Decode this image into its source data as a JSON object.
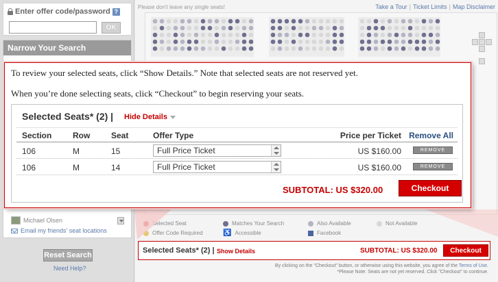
{
  "sidebar": {
    "offer_label": "Enter offer code/password",
    "offer_help": "?",
    "offer_input_value": "",
    "ok_label": "OK",
    "narrow_header": "Narrow Your Search",
    "friend_name": "Michael Olsen",
    "email_friends": "Email my friends' seat locations",
    "reset_label": "Reset Search",
    "need_help": "Need Help?"
  },
  "main": {
    "top_notice": "Please don't leave any single seats!",
    "links": [
      "Take a Tour",
      "Ticket Limits",
      "Map Disclaimer"
    ],
    "legend": [
      {
        "label": "Selected Seat",
        "shape": "dot",
        "color": "#d23a3a"
      },
      {
        "label": "Matches Your Search",
        "shape": "dot",
        "color": "#6f6f8f"
      },
      {
        "label": "Also Available",
        "shape": "dot",
        "color": "#b4b4c4"
      },
      {
        "label": "Not Available",
        "shape": "dot",
        "color": "#d8d8d8"
      },
      {
        "label": "Offer Code Required",
        "shape": "dot",
        "color": "#e6c870"
      },
      {
        "label": "Accessible",
        "shape": "icon",
        "color": "#6a7fa8"
      },
      {
        "label": "Facebook",
        "shape": "square",
        "color": "#4a65a0"
      }
    ],
    "bottom_title": "Selected Seats* (2) |",
    "bottom_show": "Show Details",
    "bottom_subtotal": "SUBTOTAL: US $320.00",
    "bottom_checkout": "Checkout",
    "terms_prefix": "By clicking on the \"Checkout\" button, or otherwise using this website, you agree of the",
    "terms_link": "Terms of Use.",
    "terms_note": "*Please Note: Seats are not yet reserved. Click \"Checkout\" to continue."
  },
  "callout": {
    "instruction1": "To review your selected seats, click “Show Details.” Note that selected seats are not reserved yet.",
    "instruction2": "When you’re done selecting seats, click “Checkout” to begin reserving your seats.",
    "panel_title": "Selected Seats* (2) |",
    "hide_details": "Hide Details",
    "headers": {
      "section": "Section",
      "row": "Row",
      "seat": "Seat",
      "offer": "Offer Type",
      "price": "Price per Ticket",
      "remove_all": "Remove All"
    },
    "rows": [
      {
        "section": "106",
        "row": "M",
        "seat": "15",
        "offer": "Full Price Ticket",
        "price": "US $160.00",
        "remove": "REMOVE"
      },
      {
        "section": "106",
        "row": "M",
        "seat": "14",
        "offer": "Full Price Ticket",
        "price": "US $160.00",
        "remove": "REMOVE"
      }
    ],
    "subtotal": "SUBTOTAL:  US $320.00",
    "checkout": "Checkout"
  },
  "colors": {
    "accent_red": "#c40000",
    "button_red": "#d40000",
    "link_blue": "#5a7aaa"
  }
}
